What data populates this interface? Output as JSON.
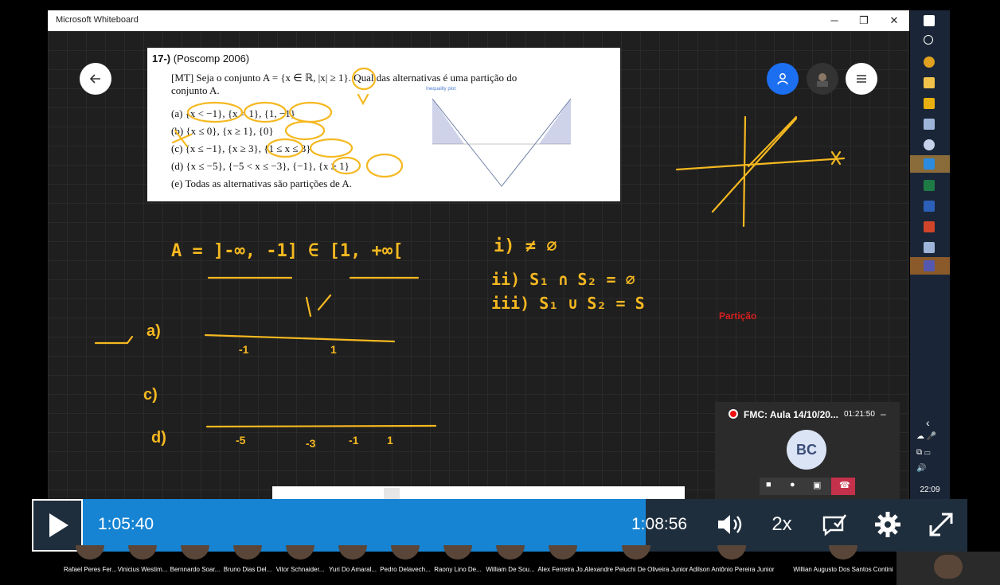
{
  "window": {
    "title": "Microsoft Whiteboard",
    "minimize_icon": "minimize-icon",
    "restore_icon": "restore-icon",
    "close_icon": "close-icon"
  },
  "whiteboard": {
    "problem": {
      "number": "17-)",
      "source": "(Poscomp 2006)",
      "statement_line1": "[MT] Seja o conjunto A = {x ∈ ℝ, |x| ≥ 1}. Qual das alternativas é uma partição do",
      "statement_line2": "conjunto A.",
      "options": [
        "(a) {x < −1}, {x > 1}, {1, −1}",
        "(b) {x ≤ 0}, {x ≥ 1}, {0}",
        "(c) {x ≤ −1}, {x ≥ 3}, {1 ≤ x ≤ 3}",
        "(d) {x ≤ −5}, {−5 < x ≤ −3}, {−1}, {x ≥ 1}",
        "(e) Todas as alternativas são partições de A."
      ],
      "plot_title": "Inequality plot:"
    },
    "red_label": "Partição",
    "handwriting": {
      "set_def": "A = ]-∞, -1] ∈ [1, +∞[",
      "cond1": "i) ≠ ∅",
      "cond2": "ii) S₁ ∩ S₂ = ∅",
      "cond3": "iii) S₁ ∪ S₂ = S",
      "label_a": "a)",
      "label_c": "c)",
      "label_d": "d)",
      "tick_neg1": "-1",
      "tick_1": "1",
      "tick_neg5": "-5",
      "tick_neg3": "-3",
      "tick_neg1b": "-1",
      "tick_1b": "1",
      "color": "#f5b820"
    }
  },
  "taskbar": {
    "clock": "22:09"
  },
  "meeting": {
    "title": "FMC: Aula 14/10/20...",
    "elapsed": "01:21:50",
    "avatar_initials": "BC",
    "minimize": "–"
  },
  "player": {
    "current_time": "1:05:40",
    "duration": "1:08:56",
    "speed": "2x",
    "progress": 0.952
  },
  "participants": [
    "Rafael Peres Fer...",
    "Vinicius Westim...",
    "Bernnardo Soar...",
    "Bruno Dias Del...",
    "Vitor Schnaider...",
    "Yuri Do Amaral...",
    "Pedro Delavech...",
    "Raony Lino De...",
    "William De Sou...",
    "Alex Ferreira Jo...",
    "Alexandre Peluchi De Oliveira Junior",
    "Adilson Antônio Pereira Junior",
    "Willian Augusto Dos Santos Contini"
  ]
}
